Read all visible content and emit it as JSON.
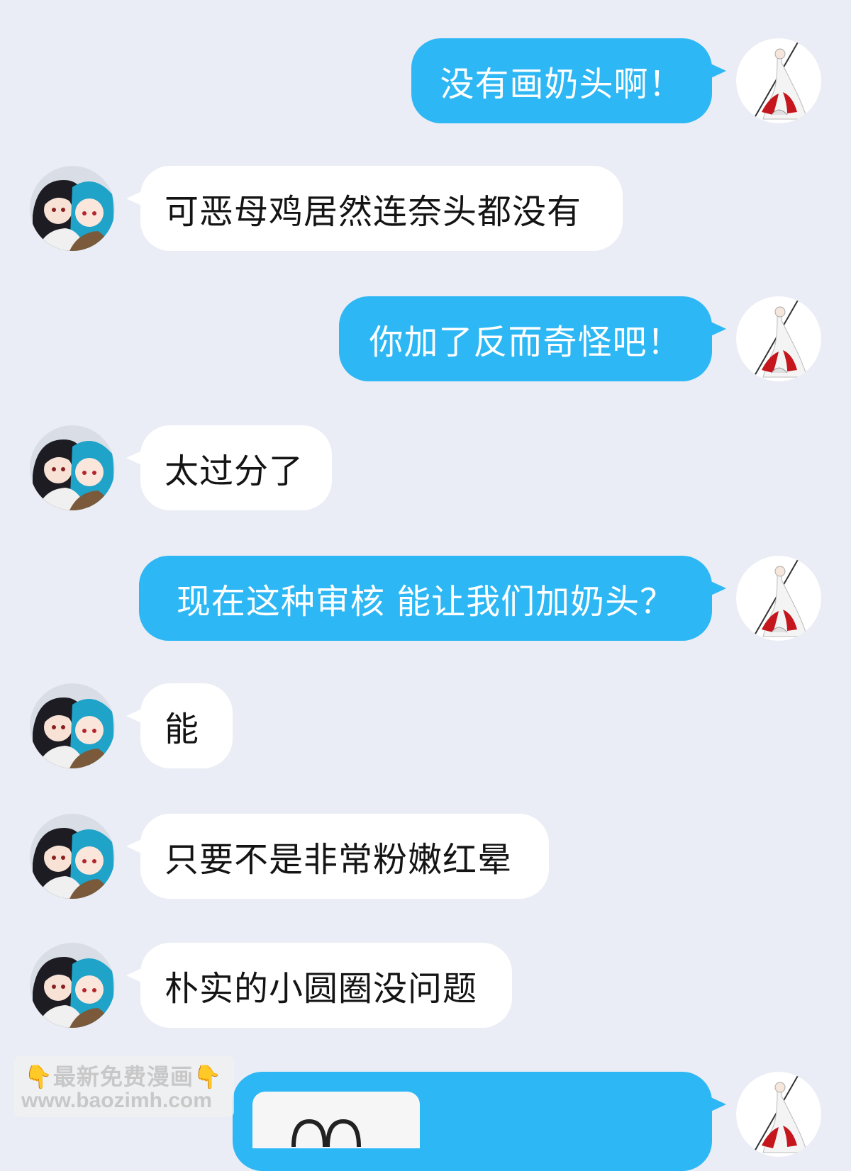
{
  "conversation": {
    "messages": [
      {
        "side": "out",
        "text": "没有画奶头啊！"
      },
      {
        "side": "in",
        "text": "可恶母鸡居然连奈头都没有"
      },
      {
        "side": "out",
        "text": "你加了反而奇怪吧！"
      },
      {
        "side": "in",
        "text": "太过分了"
      },
      {
        "side": "out",
        "text": "现在这种审核  能让我们加奶头？"
      },
      {
        "side": "in",
        "text": "能"
      },
      {
        "side": "in",
        "text": "只要不是非常粉嫩红晕"
      },
      {
        "side": "in",
        "text": "朴实的小圆圈没问题"
      },
      {
        "side": "out",
        "text": ""
      }
    ]
  },
  "colors": {
    "background": "#eaedf5",
    "outgoing_bubble": "#2db7f4",
    "incoming_bubble": "#ffffff"
  },
  "icons": {
    "self_avatar": "white-red-robed-warrior-avatar-icon",
    "other_avatar": "dark-hair-and-teal-hair-duo-avatar-icon",
    "pointing_hand": "pointing-down-hand-icon"
  },
  "watermark": {
    "line1": "最新免费漫画",
    "line2": "www.baozimh.com",
    "hand": "👇"
  }
}
